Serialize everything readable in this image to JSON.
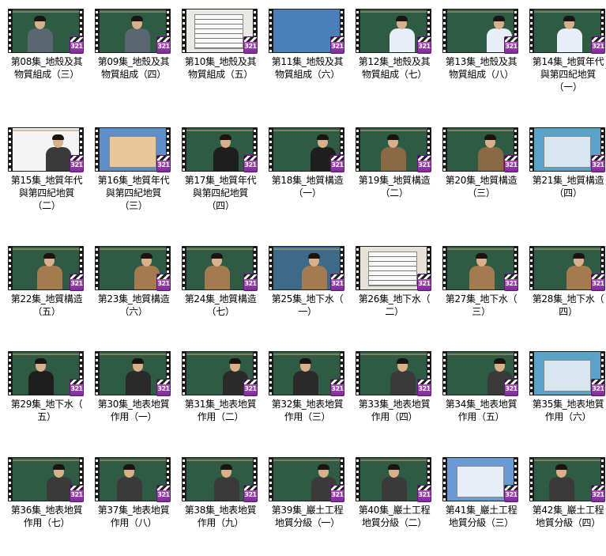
{
  "colors": {
    "board_green": "#2f5a43",
    "board_blue": "#4a7fb8",
    "slide_white": "#f2f2f2",
    "badge_purple": "#8a34a6"
  },
  "badge_text": "321",
  "items": [
    {
      "line1": "第08集_地殼及其",
      "line2": "物質組成（三）",
      "board": "#2f5a43",
      "scene": "person",
      "suit": "#5a6670"
    },
    {
      "line1": "第09集_地殼及其",
      "line2": "物質組成（四）",
      "board": "#2f5a43",
      "scene": "person",
      "suit": "#5a6670"
    },
    {
      "line1": "第10集_地殼及其",
      "line2": "物質組成（五）",
      "board": "#e8e8e4",
      "scene": "doc",
      "suit": "#666"
    },
    {
      "line1": "第11集_地殼及其",
      "line2": "物質組成（六）",
      "board": "#4a7fb8",
      "scene": "blue",
      "suit": "#666"
    },
    {
      "line1": "第12集_地殼及其",
      "line2": "物質組成（七）",
      "board": "#2f5a43",
      "scene": "person",
      "suit": "#e8eef6"
    },
    {
      "line1": "第13集_地殼及其",
      "line2": "物質組成（八）",
      "board": "#2f5a43",
      "scene": "person",
      "suit": "#e8eef6"
    },
    {
      "line1": "第14集_地質年代",
      "line2": "與第四紀地質（一）",
      "board": "#2f5a43",
      "scene": "person",
      "suit": "#e8eef6"
    },
    {
      "line1": "第15集_地質年代",
      "line2": "與第四紀地質（二）",
      "board": "#f4f4f4",
      "scene": "person",
      "suit": "#3a3a3a"
    },
    {
      "line1": "第16集_地質年代",
      "line2": "與第四紀地質（三）",
      "board": "#5f8fc8",
      "scene": "map",
      "suit": "#666"
    },
    {
      "line1": "第17集_地質年代",
      "line2": "與第四紀地質（四）",
      "board": "#2f5a43",
      "scene": "person",
      "suit": "#1e1e1e"
    },
    {
      "line1": "第18集_地質構造",
      "line2": "（一）",
      "board": "#2f5a43",
      "scene": "person",
      "suit": "#1e1e1e"
    },
    {
      "line1": "第19集_地質構造",
      "line2": "（二）",
      "board": "#2f5a43",
      "scene": "person",
      "suit": "#8a6a45"
    },
    {
      "line1": "第20集_地質構造",
      "line2": "（三）",
      "board": "#2f5a43",
      "scene": "person",
      "suit": "#8a6a45"
    },
    {
      "line1": "第21集_地質構造",
      "line2": "（四）",
      "board": "#5aa3c8",
      "scene": "slide",
      "suit": "#666"
    },
    {
      "line1": "第22集_地質構造",
      "line2": "（五）",
      "board": "#2f5a43",
      "scene": "person",
      "suit": "#a57a4e"
    },
    {
      "line1": "第23集_地質構造",
      "line2": "（六）",
      "board": "#2f5a43",
      "scene": "person",
      "suit": "#a57a4e"
    },
    {
      "line1": "第24集_地質構造",
      "line2": "（七）",
      "board": "#2f5a43",
      "scene": "person",
      "suit": "#a57a4e"
    },
    {
      "line1": "第25集_地下水（",
      "line2": "一）",
      "board": "#3e6a8a",
      "scene": "person",
      "suit": "#a57a4e"
    },
    {
      "line1": "第26集_地下水（",
      "line2": "二）",
      "board": "#e6e2d8",
      "scene": "doc",
      "suit": "#666"
    },
    {
      "line1": "第27集_地下水（",
      "line2": "三）",
      "board": "#2f5a43",
      "scene": "person",
      "suit": "#a57a4e"
    },
    {
      "line1": "第28集_地下水（",
      "line2": "四）",
      "board": "#2f5a43",
      "scene": "person",
      "suit": "#a57a4e"
    },
    {
      "line1": "第29集_地下水（",
      "line2": "五）",
      "board": "#2f5a43",
      "scene": "person",
      "suit": "#1e1e1e"
    },
    {
      "line1": "第30集_地表地質",
      "line2": "作用（一）",
      "board": "#2f5a43",
      "scene": "person",
      "suit": "#2a2a2a"
    },
    {
      "line1": "第31集_地表地質",
      "line2": "作用（二）",
      "board": "#2f5a43",
      "scene": "person",
      "suit": "#2a2a2a"
    },
    {
      "line1": "第32集_地表地質",
      "line2": "作用（三）",
      "board": "#2f5a43",
      "scene": "person",
      "suit": "#2a2a2a"
    },
    {
      "line1": "第33集_地表地質",
      "line2": "作用（四）",
      "board": "#2f5a43",
      "scene": "person",
      "suit": "#3a3a3a"
    },
    {
      "line1": "第34集_地表地質",
      "line2": "作用（五）",
      "board": "#2f5a43",
      "scene": "person",
      "suit": "#3a3a3a"
    },
    {
      "line1": "第35集_地表地質",
      "line2": "作用（六）",
      "board": "#5aa3c8",
      "scene": "slide",
      "suit": "#666"
    },
    {
      "line1": "第36集_地表地質",
      "line2": "作用（七）",
      "board": "#2f5a43",
      "scene": "person",
      "suit": "#3a3a3a"
    },
    {
      "line1": "第37集_地表地質",
      "line2": "作用（八）",
      "board": "#2f5a43",
      "scene": "person",
      "suit": "#3a3a3a"
    },
    {
      "line1": "第38集_地表地質",
      "line2": "作用（九）",
      "board": "#2f5a43",
      "scene": "person",
      "suit": "#3a3a3a"
    },
    {
      "line1": "第39集_巖土工程",
      "line2": "地質分級（一）",
      "board": "#2f5a43",
      "scene": "person",
      "suit": "#3a3a3a"
    },
    {
      "line1": "第40集_巖土工程",
      "line2": "地質分級（二）",
      "board": "#2f5a43",
      "scene": "person",
      "suit": "#3a3a3a"
    },
    {
      "line1": "第41集_巖土工程",
      "line2": "地質分級（三）",
      "board": "#6a9ad4",
      "scene": "table",
      "suit": "#666"
    },
    {
      "line1": "第42集_巖土工程",
      "line2": "地質分級（四）",
      "board": "#2f5a43",
      "scene": "person",
      "suit": "#3a3a3a"
    }
  ]
}
